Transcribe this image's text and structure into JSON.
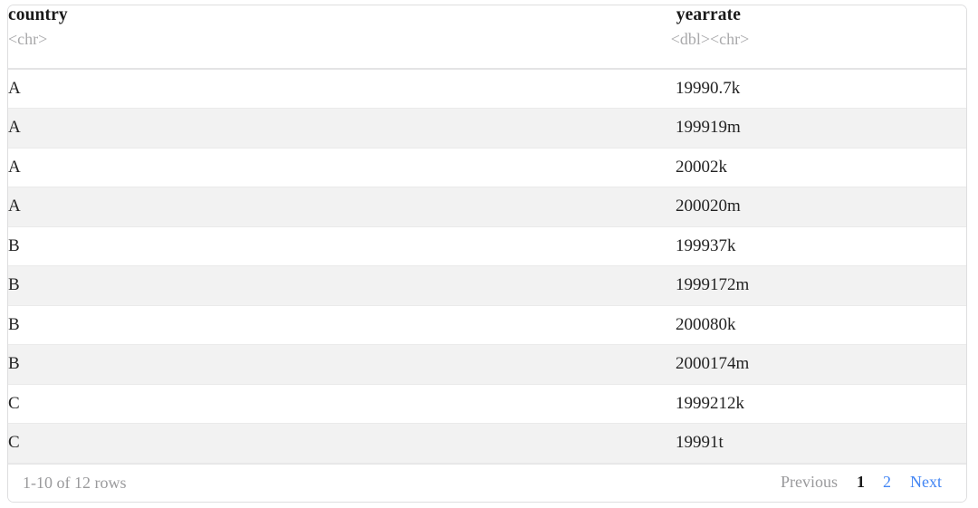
{
  "table": {
    "columns": [
      {
        "name": "country",
        "type": "<chr>",
        "align": "left"
      },
      {
        "name": "year",
        "type": "<dbl>",
        "align": "right"
      },
      {
        "name": "rate",
        "type": "<chr>",
        "align": "left"
      }
    ],
    "rows": [
      {
        "country": "A",
        "year": "1999",
        "rate": "0.7k"
      },
      {
        "country": "A",
        "year": "1999",
        "rate": "19m"
      },
      {
        "country": "A",
        "year": "2000",
        "rate": "2k"
      },
      {
        "country": "A",
        "year": "2000",
        "rate": "20m"
      },
      {
        "country": "B",
        "year": "1999",
        "rate": "37k"
      },
      {
        "country": "B",
        "year": "1999",
        "rate": "172m"
      },
      {
        "country": "B",
        "year": "2000",
        "rate": "80k"
      },
      {
        "country": "B",
        "year": "2000",
        "rate": "174m"
      },
      {
        "country": "C",
        "year": "1999",
        "rate": "212k"
      },
      {
        "country": "C",
        "year": "1999",
        "rate": "1t"
      }
    ]
  },
  "pagination": {
    "info": "1-10 of 12 rows",
    "previous_label": "Previous",
    "next_label": "Next",
    "pages": [
      {
        "label": "1",
        "current": true
      },
      {
        "label": "2",
        "current": false
      }
    ],
    "previous_disabled": true,
    "next_disabled": false
  },
  "colors": {
    "link": "#4285f4",
    "muted": "#9a9a9c",
    "text": "#232323",
    "stripe": "#f2f2f2",
    "border": "#dededf"
  }
}
